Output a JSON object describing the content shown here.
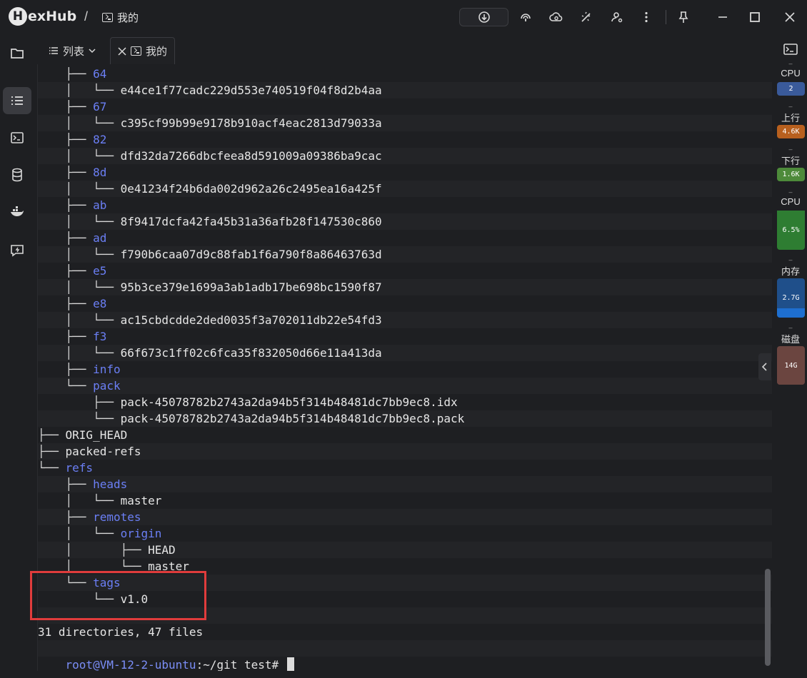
{
  "app": {
    "name": "exHub",
    "logo_letter": "H",
    "breadcrumb_separator": "/",
    "breadcrumb_current": "我的"
  },
  "tabs": [
    {
      "label": "列表"
    },
    {
      "label": "我的"
    }
  ],
  "terminal": {
    "lines": [
      {
        "guide": "    ├── ",
        "name": "64",
        "kind": "dir"
      },
      {
        "guide": "    │   └── ",
        "name": "e44ce1f77cadc229d553e740519f04f8d2b4aa",
        "kind": "file"
      },
      {
        "guide": "    ├── ",
        "name": "67",
        "kind": "dir"
      },
      {
        "guide": "    │   └── ",
        "name": "c395cf99b99e9178b910acf4eac2813d79033a",
        "kind": "file"
      },
      {
        "guide": "    ├── ",
        "name": "82",
        "kind": "dir"
      },
      {
        "guide": "    │   └── ",
        "name": "dfd32da7266dbcfeea8d591009a09386ba9cac",
        "kind": "file"
      },
      {
        "guide": "    ├── ",
        "name": "8d",
        "kind": "dir"
      },
      {
        "guide": "    │   └── ",
        "name": "0e41234f24b6da002d962a26c2495ea16a425f",
        "kind": "file"
      },
      {
        "guide": "    ├── ",
        "name": "ab",
        "kind": "dir"
      },
      {
        "guide": "    │   └── ",
        "name": "8f9417dcfa42fa45b31a36afb28f147530c860",
        "kind": "file"
      },
      {
        "guide": "    ├── ",
        "name": "ad",
        "kind": "dir"
      },
      {
        "guide": "    │   └── ",
        "name": "f790b6caa07d9c88fab1f6a790f8a86463763d",
        "kind": "file"
      },
      {
        "guide": "    ├── ",
        "name": "e5",
        "kind": "dir"
      },
      {
        "guide": "    │   └── ",
        "name": "95b3ce379e1699a3ab1adb17be698bc1590f87",
        "kind": "file"
      },
      {
        "guide": "    ├── ",
        "name": "e8",
        "kind": "dir"
      },
      {
        "guide": "    │   └── ",
        "name": "ac15cbdcdde2ded0035f3a702011db22e54fd3",
        "kind": "file"
      },
      {
        "guide": "    ├── ",
        "name": "f3",
        "kind": "dir"
      },
      {
        "guide": "    │   └── ",
        "name": "66f673c1ff02c6fca35f832050d66e11a413da",
        "kind": "file"
      },
      {
        "guide": "    ├── ",
        "name": "info",
        "kind": "dir"
      },
      {
        "guide": "    └── ",
        "name": "pack",
        "kind": "dir"
      },
      {
        "guide": "        ├── ",
        "name": "pack-45078782b2743a2da94b5f314b48481dc7bb9ec8.idx",
        "kind": "file"
      },
      {
        "guide": "        └── ",
        "name": "pack-45078782b2743a2da94b5f314b48481dc7bb9ec8.pack",
        "kind": "file"
      },
      {
        "guide": "├── ",
        "name": "ORIG_HEAD",
        "kind": "file"
      },
      {
        "guide": "├── ",
        "name": "packed-refs",
        "kind": "file"
      },
      {
        "guide": "└── ",
        "name": "refs",
        "kind": "dir"
      },
      {
        "guide": "    ├── ",
        "name": "heads",
        "kind": "dir"
      },
      {
        "guide": "    │   └── ",
        "name": "master",
        "kind": "file"
      },
      {
        "guide": "    ├── ",
        "name": "remotes",
        "kind": "dir"
      },
      {
        "guide": "    │   └── ",
        "name": "origin",
        "kind": "dir"
      },
      {
        "guide": "    │       ├── ",
        "name": "HEAD",
        "kind": "file"
      },
      {
        "guide": "    │       └── ",
        "name": "master",
        "kind": "file"
      },
      {
        "guide": "    └── ",
        "name": "tags",
        "kind": "dir"
      },
      {
        "guide": "        └── ",
        "name": "v1.0",
        "kind": "file"
      },
      {
        "guide": "",
        "name": "",
        "kind": "file"
      },
      {
        "guide": "",
        "name": "31 directories, 47 files",
        "kind": "file"
      }
    ],
    "prompt_user": "root@VM-12-2-ubuntu",
    "prompt_path": ":~/git_test#",
    "highlight_color": "#e03c3c"
  },
  "monitor": {
    "cpu_cores_label": "CPU",
    "cpu_cores_value": "2",
    "upload_label": "上行",
    "upload_value": "4.6K",
    "download_label": "下行",
    "download_value": "1.6K",
    "cpu_usage_label": "CPU",
    "cpu_usage_value": "6.5%",
    "memory_label": "内存",
    "memory_value": "2.7G",
    "disk_label": "磁盘",
    "disk_value": "14G",
    "dash": "–"
  },
  "colors": {
    "accent_dir": "#6b7ff5",
    "cpu_badge": "#3a5a9a",
    "upload_badge": "#b8601e",
    "download_badge": "#4d8a3a",
    "cpu_usage_badge": "#2e7d32",
    "memory_badge": "#1f4f8a",
    "disk_badge": "#6b4540"
  }
}
